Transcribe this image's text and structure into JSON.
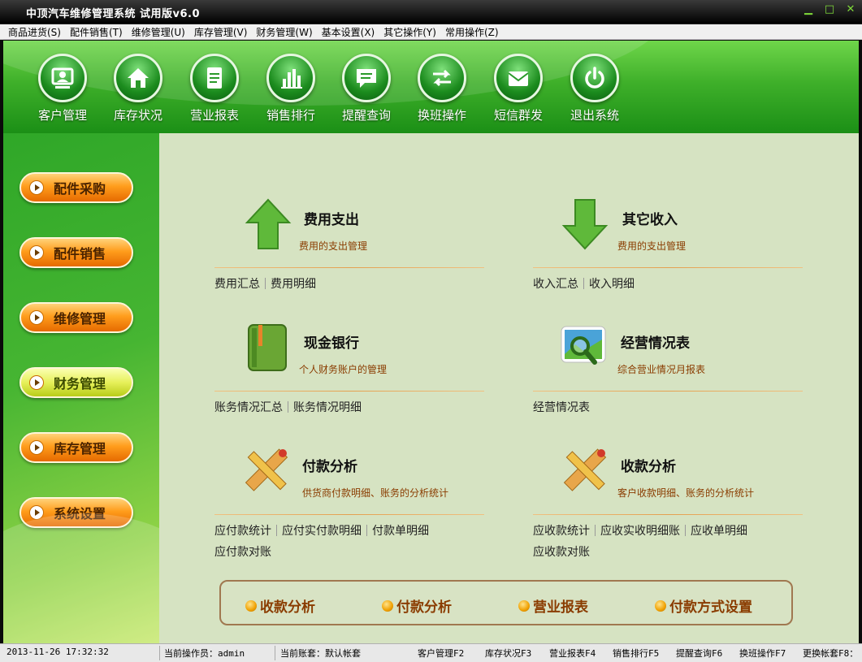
{
  "window": {
    "title": "中顶汽车维修管理系统 试用版v6.0",
    "buttons": [
      "▁",
      "□",
      "✕"
    ]
  },
  "menu": [
    "商品进货(S)",
    "配件销售(T)",
    "维修管理(U)",
    "库存管理(V)",
    "财务管理(W)",
    "基本设置(X)",
    "其它操作(Y)",
    "常用操作(Z)"
  ],
  "toolbar": [
    {
      "label": "客户管理",
      "icon": "customer-icon"
    },
    {
      "label": "库存状况",
      "icon": "home-icon"
    },
    {
      "label": "营业报表",
      "icon": "report-icon"
    },
    {
      "label": "销售排行",
      "icon": "bar-chart-icon"
    },
    {
      "label": "提醒查询",
      "icon": "message-icon"
    },
    {
      "label": "换班操作",
      "icon": "swap-icon"
    },
    {
      "label": "短信群发",
      "icon": "sms-icon"
    },
    {
      "label": "退出系统",
      "icon": "power-icon"
    }
  ],
  "sidebar": [
    {
      "label": "配件采购",
      "active": false
    },
    {
      "label": "配件销售",
      "active": false
    },
    {
      "label": "维修管理",
      "active": false
    },
    {
      "label": "财务管理",
      "active": true
    },
    {
      "label": "库存管理",
      "active": false
    },
    {
      "label": "系统设置",
      "active": false
    }
  ],
  "sections": {
    "expense": {
      "title": "费用支出",
      "desc": "费用的支出管理",
      "links": [
        "费用汇总",
        "费用明细"
      ],
      "icon": "arrow-up-icon"
    },
    "income": {
      "title": "其它收入",
      "desc": "费用的支出管理",
      "links": [
        "收入汇总",
        "收入明细"
      ],
      "icon": "arrow-down-icon"
    },
    "cash": {
      "title": "现金银行",
      "desc": "个人财务账户的管理",
      "links": [
        "账务情况汇总",
        "账务情况明细"
      ],
      "icon": "notebook-icon"
    },
    "business": {
      "title": "经营情况表",
      "desc": "综合营业情况月报表",
      "links": [
        "经营情况表"
      ],
      "icon": "magnifier-icon"
    },
    "payment": {
      "title": "付款分析",
      "desc": "供货商付款明细、账务的分析统计",
      "links": [
        "应付款统计",
        "应付实付款明细",
        "付款单明细"
      ],
      "links2": [
        "应付款对账"
      ],
      "icon": "ruler-pencil-icon"
    },
    "receipt": {
      "title": "收款分析",
      "desc": "客户收款明细、账务的分析统计",
      "links": [
        "应收款统计",
        "应收实收明细账",
        "应收单明细"
      ],
      "links2": [
        "应收款对账"
      ],
      "icon": "ruler-pencil-icon"
    }
  },
  "quick": [
    "收款分析",
    "付款分析",
    "营业报表",
    "付款方式设置"
  ],
  "status": {
    "datetime": "2013-11-26 17:32:32",
    "operator": "当前操作员：admin",
    "account": "当前账套：默认帐套",
    "shortcuts": [
      "客户管理F2",
      "库存状况F3",
      "营业报表F4",
      "销售排行F5",
      "提醒查询F6",
      "换班操作F7",
      "更换帐套F8："
    ]
  },
  "colors": {
    "accent_green": "#2fa728",
    "orange": "#ff9d1c",
    "content_bg": "#d6e3c2",
    "desc_text": "#8a3c00"
  }
}
